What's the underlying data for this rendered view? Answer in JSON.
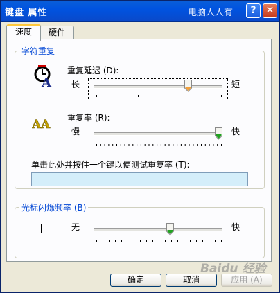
{
  "window": {
    "title": "键盘 属性",
    "watermark": "电脑人人有"
  },
  "titlebar": {
    "help": "?",
    "close": "✕"
  },
  "tabs": [
    {
      "label": "速度"
    },
    {
      "label": "硬件"
    }
  ],
  "group_repeat": {
    "legend": "字符重复",
    "delay": {
      "label": "重复延迟 (D):",
      "min": "长",
      "max": "短",
      "value_fraction": 0.75
    },
    "rate": {
      "label": "重复率 (R):",
      "min": "慢",
      "max": "快",
      "value_fraction": 1.0
    },
    "test_label": "单击此处并按住一个键以便测试重复率 (T):",
    "test_value": ""
  },
  "group_cursor": {
    "legend": "光标闪烁频率 (B)",
    "min": "无",
    "max": "快",
    "value_fraction": 0.6
  },
  "buttons": {
    "ok": "确定",
    "cancel": "取消",
    "apply": "应用 (A)"
  },
  "watermark_bottom": "Baidu 经验",
  "colors": {
    "title_blue": "#0053e0",
    "legend_blue": "#0046d5",
    "test_box": "#d4eefa"
  }
}
